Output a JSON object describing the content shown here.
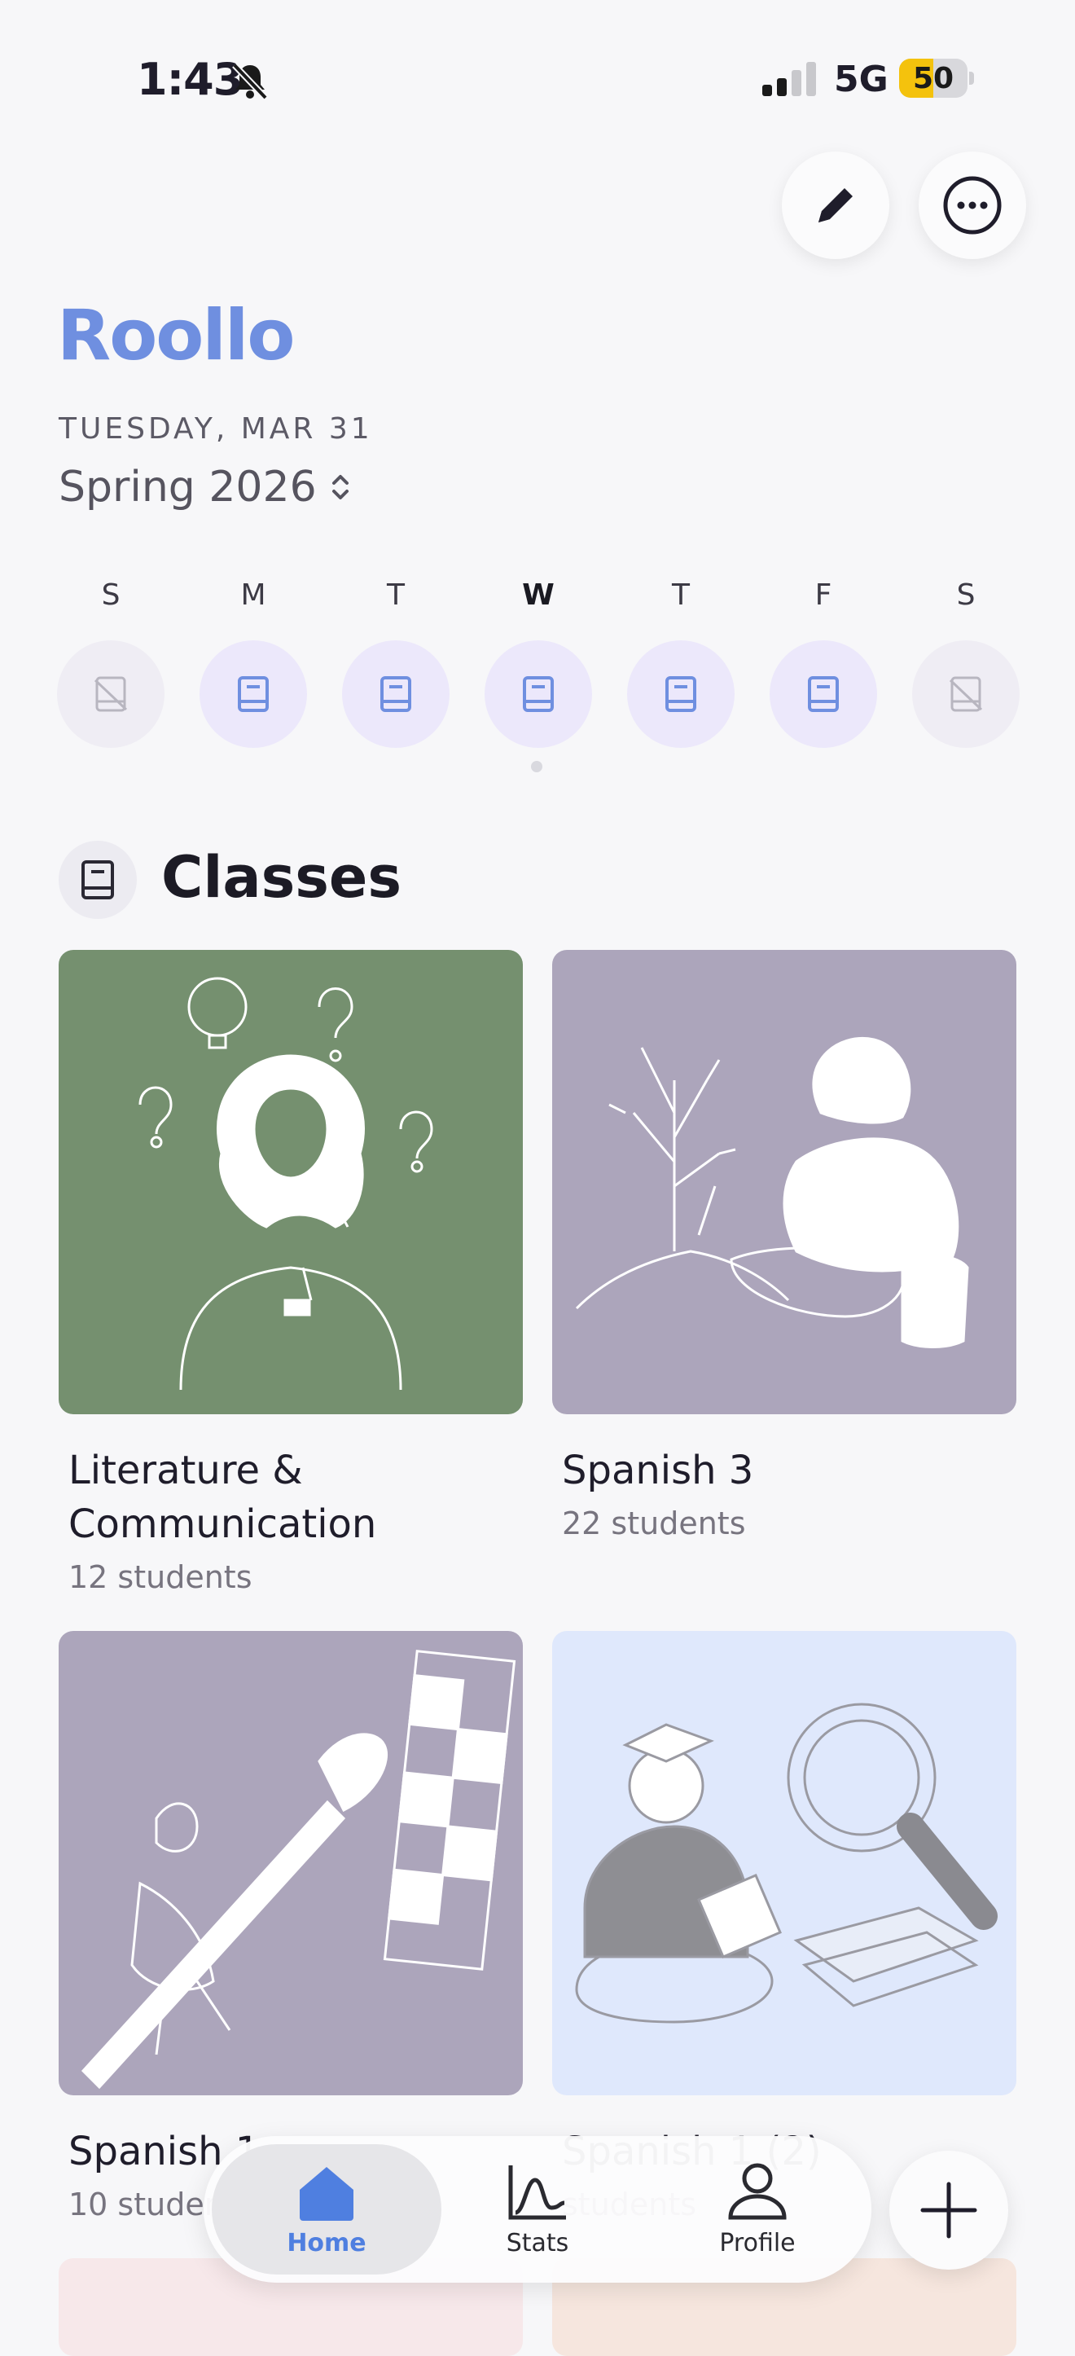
{
  "status_bar": {
    "time": "1:43",
    "network": "5G",
    "battery": "50",
    "battery_level": 0.5
  },
  "header": {
    "logo": "Roollo",
    "date": "TUESDAY, MAR 31",
    "term": "Spring 2026"
  },
  "week": [
    {
      "letter": "S",
      "state": "off",
      "today": false
    },
    {
      "letter": "M",
      "state": "active",
      "today": false
    },
    {
      "letter": "T",
      "state": "active",
      "today": false
    },
    {
      "letter": "W",
      "state": "active",
      "today": true
    },
    {
      "letter": "T",
      "state": "active",
      "today": false
    },
    {
      "letter": "F",
      "state": "active",
      "today": false
    },
    {
      "letter": "S",
      "state": "off",
      "today": false
    }
  ],
  "section": {
    "title": "Classes"
  },
  "classes": [
    {
      "name": "Literature & Communication",
      "count": "12 students",
      "color": "#75906f"
    },
    {
      "name": "Spanish 3",
      "count": "22 students",
      "color": "#aca5bb"
    },
    {
      "name": "Spanish 1",
      "count": "10 students",
      "color": "#aca5bb"
    },
    {
      "name": "Spanish 1 (2)",
      "count": "students",
      "color": "#dfe8fc"
    }
  ],
  "tabbar": {
    "home": "Home",
    "stats": "Stats",
    "profile": "Profile"
  },
  "colors": {
    "accent": "#6f8fe0",
    "tab_active": "#4f7fe0"
  }
}
